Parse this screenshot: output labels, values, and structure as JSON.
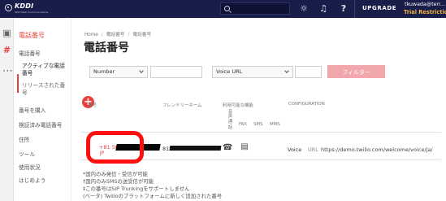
{
  "topbar": {
    "logo_text": "KDDI",
    "logo_sub": "KDDI Web Communications",
    "upgrade": "UPGRADE",
    "account_name": "tkuwada@terr...",
    "trial_text": "Trial Restriction"
  },
  "sidebar": {
    "title": "電話番号",
    "items": [
      {
        "label": "電話番号"
      },
      {
        "label": "アクティブな電話"
      },
      {
        "label": "番号"
      },
      {
        "label": "リリースされた番"
      },
      {
        "label": "号"
      },
      {
        "label": "番号を購入"
      },
      {
        "label": "検証済み電話番号"
      },
      {
        "label": "住所"
      },
      {
        "label": "ツール"
      },
      {
        "label": "使用状況"
      },
      {
        "label": "はじめよう"
      }
    ]
  },
  "breadcrumb": {
    "home": "Home",
    "sep": "/",
    "crumb_1": "電話番号",
    "crumb_2": "電話番号"
  },
  "page": {
    "title": "電話番号"
  },
  "filters": {
    "number_select": "Number",
    "voice_select": "Voice URL",
    "filter_button": "フィルター"
  },
  "table": {
    "headers": {
      "number": "番号",
      "friendly": "フレンドリーネーム",
      "capabilities": "利用可能な機能",
      "configuration": "CONFIGURATION",
      "voice_col": "音声通話",
      "fax": "FAX",
      "sms": "SMS",
      "mms": "MMS"
    },
    "row": {
      "number_prefix": "+81 50",
      "number_suffix": "JP",
      "friendly_prefix": "815",
      "config_type": "Voice",
      "config_url_label": "URL",
      "config_url": "https://demo.twilio.com/welcome/voice/ja/"
    }
  },
  "footnotes": [
    "*国内のみ発信・受信が可能",
    "†国内のみSMSの送受信が可能",
    "‡この番号はSIP Trunkingをサポートしません",
    "(ベータ) Twilioのプラットフォームに新しく追加された番号"
  ],
  "icons": {
    "search": "search-icon",
    "bug": "bug-icon",
    "bell": "bell-icon",
    "help": "help-icon",
    "home": "home-icon",
    "phone": "hash-icon",
    "more": "more-icon",
    "add": "plus-icon",
    "voice": "phone-icon",
    "fax": "fax-icon"
  },
  "colors": {
    "topbar": "#191d4a",
    "accent": "#e9403a",
    "warning": "#f1b23b",
    "highlight": "#ff1010"
  }
}
